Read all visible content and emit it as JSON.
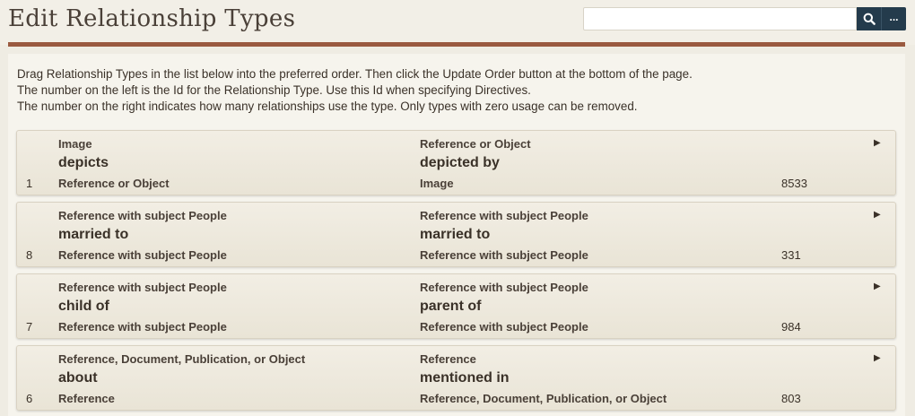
{
  "page": {
    "title": "Edit Relationship Types"
  },
  "search": {
    "value": "",
    "placeholder": "",
    "search_icon": "search-icon",
    "more_label": "..."
  },
  "intro": {
    "line1": "Drag Relationship Types in the list below into the preferred order. Then click the Update Order button at the bottom of the page.",
    "line2": "The number on the left is the Id for the Relationship Type. Use this Id when specifying Directives.",
    "line3": "The number on the right indicates how many relationships use the type. Only types with zero usage can be removed."
  },
  "rows": [
    {
      "id": "1",
      "left_top": "Image",
      "left_label": "depicts",
      "left_bottom": "Reference or Object",
      "right_top": "Reference or Object",
      "right_label": "depicted by",
      "right_bottom": "Image",
      "count": "8533"
    },
    {
      "id": "8",
      "left_top": "Reference with subject People",
      "left_label": "married to",
      "left_bottom": "Reference with subject People",
      "right_top": "Reference with subject People",
      "right_label": "married to",
      "right_bottom": "Reference with subject People",
      "count": "331"
    },
    {
      "id": "7",
      "left_top": "Reference with subject People",
      "left_label": "child of",
      "left_bottom": "Reference with subject People",
      "right_top": "Reference with subject People",
      "right_label": "parent of",
      "right_bottom": "Reference with subject People",
      "count": "984"
    },
    {
      "id": "6",
      "left_top": "Reference, Document, Publication, or Object",
      "left_label": "about",
      "left_bottom": "Reference",
      "right_top": "Reference",
      "right_label": "mentioned in",
      "right_bottom": "Reference, Document, Publication, or Object",
      "count": "803"
    }
  ],
  "colors": {
    "accent_rule": "#9a5a40",
    "button_bg": "#243b4c",
    "page_bg": "#efece3"
  }
}
